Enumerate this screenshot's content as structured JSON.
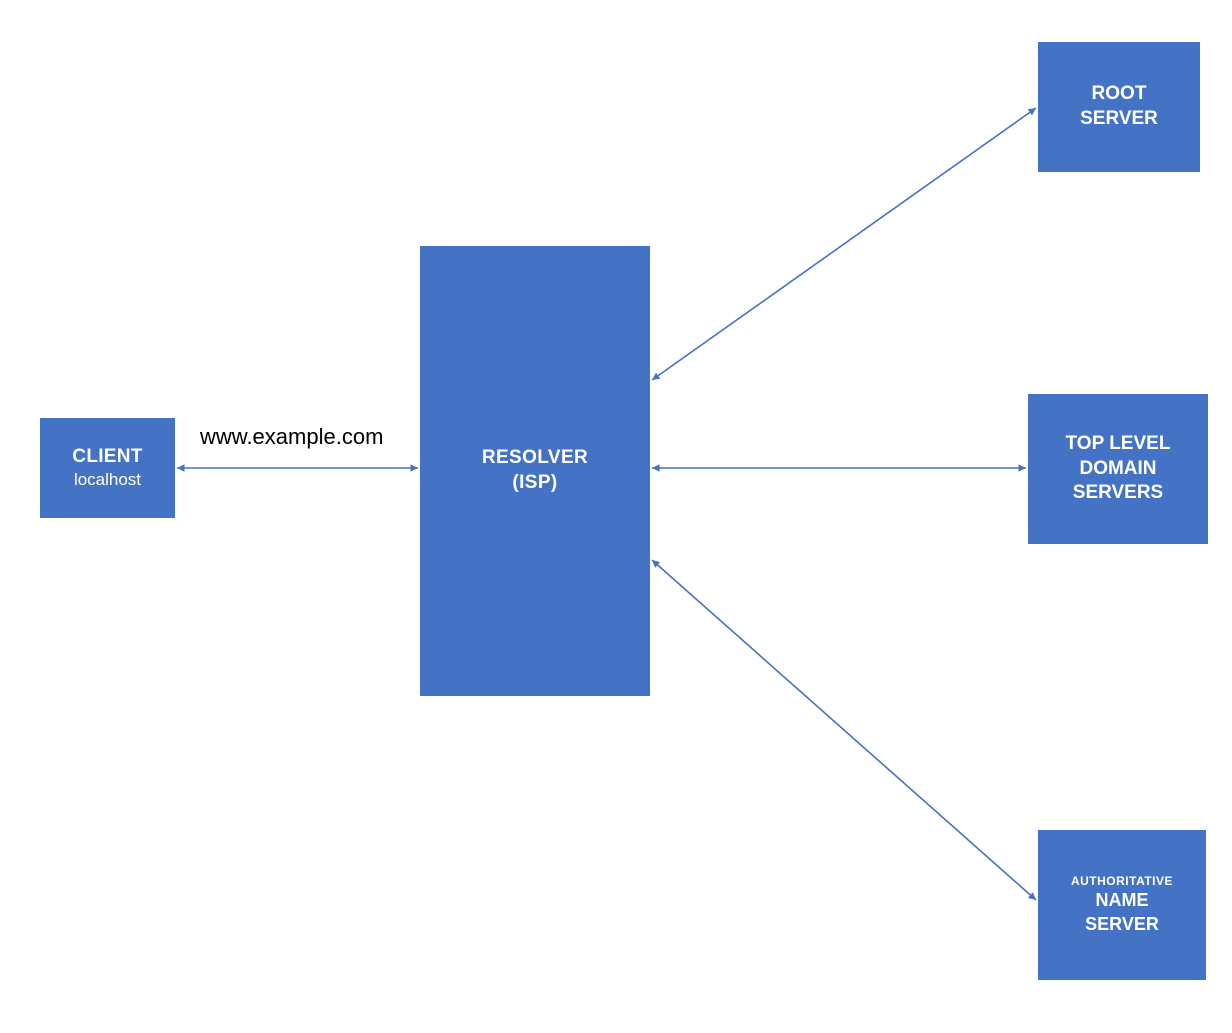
{
  "colors": {
    "box_fill": "#4472c4",
    "arrow_stroke": "#4472c4",
    "text_on_box": "#ffffff",
    "label_text": "#000000",
    "background": "#ffffff"
  },
  "nodes": {
    "client": {
      "title": "CLIENT",
      "subtitle": "localhost"
    },
    "resolver": {
      "line1": "RESOLVER",
      "line2": "(ISP)"
    },
    "root": {
      "line1": "ROOT",
      "line2": "SERVER"
    },
    "tld": {
      "line1": "TOP LEVEL",
      "line2": "DOMAIN",
      "line3": "SERVERS"
    },
    "auth": {
      "super": "AUTHORITATIVE",
      "line1": "NAME",
      "line2": "SERVER"
    }
  },
  "edge_label": "www.example.com",
  "edges": [
    {
      "from": "client",
      "to": "resolver",
      "bidirectional": true,
      "label": "www.example.com"
    },
    {
      "from": "resolver",
      "to": "root",
      "bidirectional": true
    },
    {
      "from": "resolver",
      "to": "tld",
      "bidirectional": true
    },
    {
      "from": "resolver",
      "to": "auth",
      "bidirectional": true
    }
  ]
}
